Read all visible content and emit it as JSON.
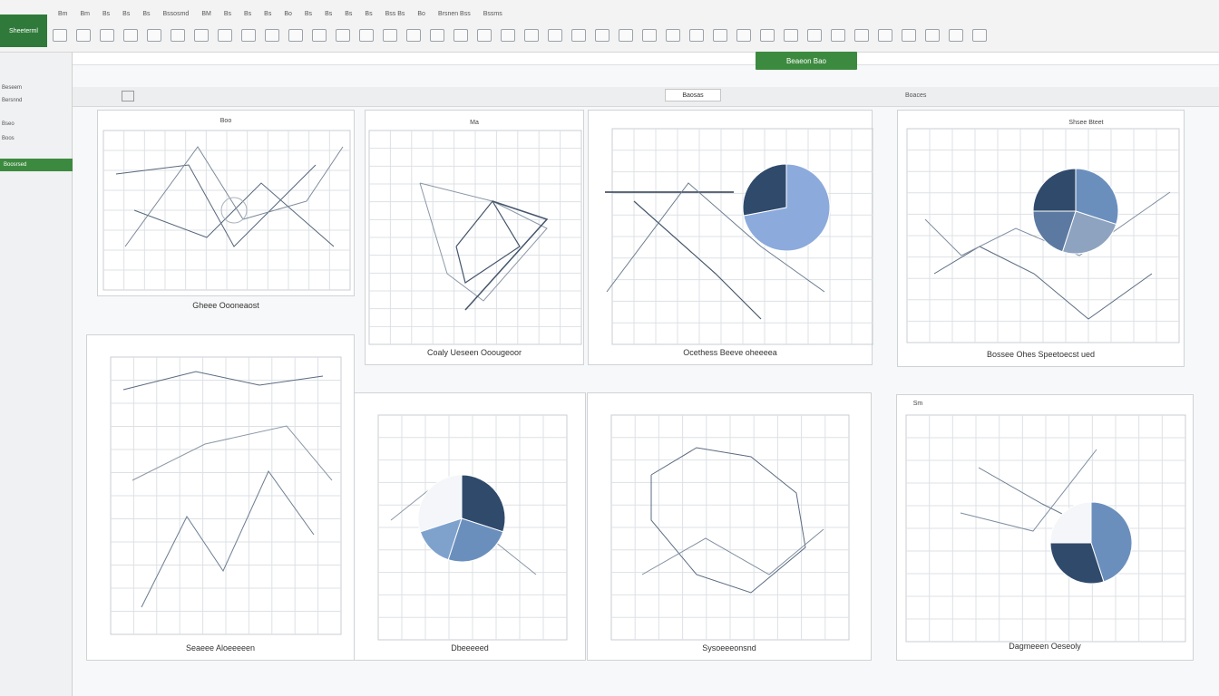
{
  "ribbon": {
    "app_badge": "Sheeterml",
    "tabs": [
      "Bm",
      "Bm",
      "Bs",
      "Bs",
      "Bs",
      "Bssosmd",
      "BM",
      "Bs",
      "Bs",
      "Bs",
      "Bo",
      "Bs",
      "Bs",
      "Bs",
      "Bs",
      "Bss Bs",
      "Bo",
      "Brsnen Bss",
      "Bssms"
    ],
    "cta_label": "Beaeon Bao"
  },
  "sidebar": {
    "items": [
      "Beseem",
      "Bersnnd",
      "Bseo",
      "Boos"
    ],
    "active_label": "Boosrsed"
  },
  "subbar": {
    "selector_label": "Baosas",
    "right_label": "Boaces"
  },
  "panels": {
    "p1": {
      "title": "Boo",
      "caption": "Gheee Oooneaost"
    },
    "p2": {
      "title": "Ma",
      "caption": "Coaly Ueseen Ooougeoor"
    },
    "p3": {
      "title": "",
      "caption": "Ocethess Beeve oheeeea"
    },
    "p4": {
      "title": "Shsee Bteet",
      "caption": "Bossee Ohes Speetoecst ued"
    },
    "p5": {
      "title": "",
      "caption": "Seaeee Aloeeeeen"
    },
    "p6": {
      "title": "",
      "caption": "Dbeeeeed"
    },
    "p7": {
      "title": "",
      "caption": "Sysoeeeonsnd"
    },
    "p8": {
      "title": "Sm",
      "caption": "Dagmeeen Oeseoly"
    }
  },
  "colors": {
    "accent_green": "#3c8a3f",
    "pie_light": "#8caadc",
    "pie_mid": "#6b8fbd",
    "pie_dark": "#2f4a6b"
  }
}
